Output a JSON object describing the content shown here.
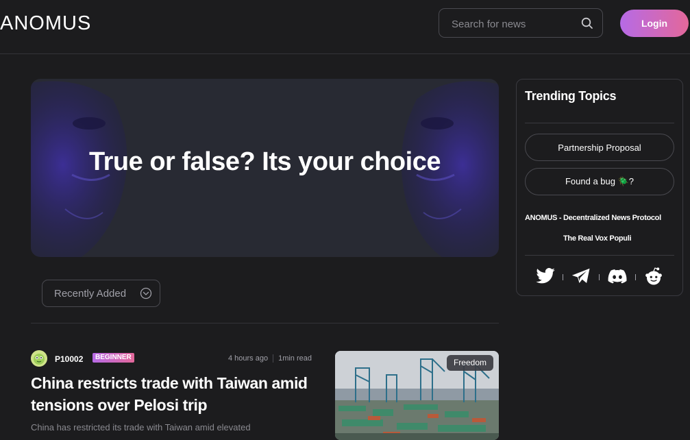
{
  "header": {
    "logo": "ANOMUS",
    "search_placeholder": "Search for news",
    "login_label": "Login"
  },
  "hero": {
    "title": "True or false? Its your choice"
  },
  "filter": {
    "label": "Recently Added"
  },
  "article": {
    "author": "P10002",
    "badge": "BEGINNER",
    "time_ago": "4 hours ago",
    "read_time": "1min read",
    "title": "China restricts trade with Taiwan amid tensions over Pelosi trip",
    "excerpt": "China has restricted its trade with Taiwan amid elevated",
    "tag": "Freedom"
  },
  "sidebar": {
    "title": "Trending Topics",
    "topics": [
      "Partnership Proposal",
      "Found a bug 🪲?"
    ],
    "tagline_main": "ANOMUS - Decentralized News Protocol",
    "tagline_sub": "The Real Vox Populi",
    "socials": [
      "twitter-icon",
      "telegram-icon",
      "discord-icon",
      "reddit-icon"
    ]
  },
  "colors": {
    "background": "#1c1c1e",
    "accent_start": "#b66ae6",
    "accent_end": "#e3689a",
    "border": "#4a4a50"
  }
}
